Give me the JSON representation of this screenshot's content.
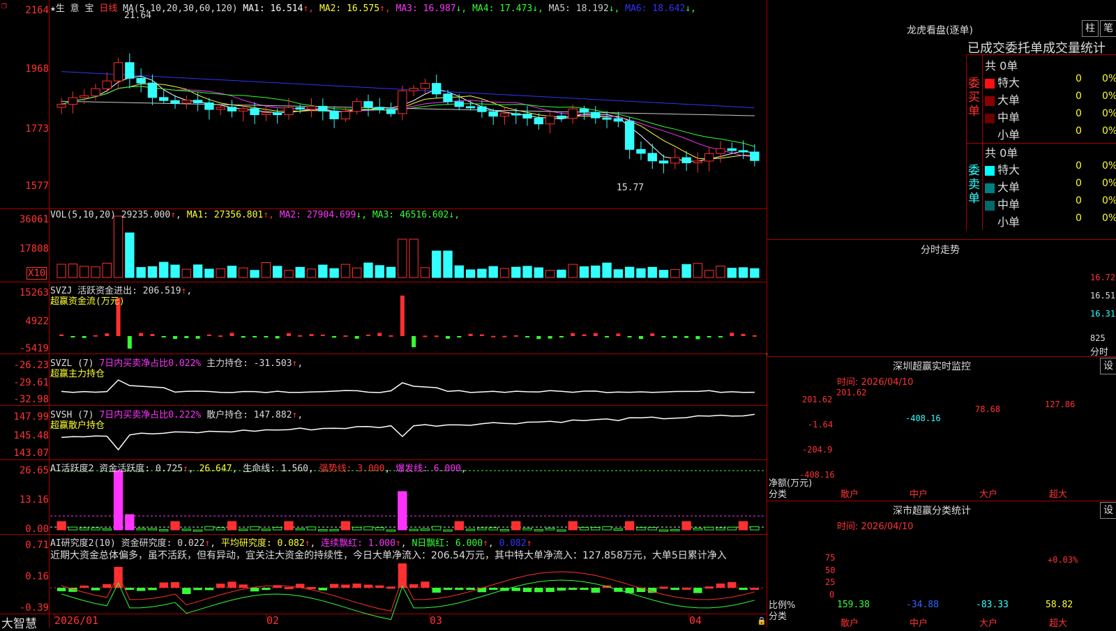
{
  "main_chart": {
    "stock_label": "★生 意 宝",
    "period_label": "日线",
    "ma_params": "MA(5,10,20,30,60,120)",
    "ma_items": [
      {
        "label": "MA1: 16.514",
        "arrow": "↑",
        "color": "#ffffff",
        "arrow_color": "#ff3030"
      },
      {
        "label": "MA2: 16.575",
        "arrow": "↑",
        "color": "#ffff33",
        "arrow_color": "#ff3030"
      },
      {
        "label": "MA3: 16.987",
        "arrow": "↓",
        "color": "#ff33ff",
        "arrow_color": "#33ff33"
      },
      {
        "label": "MA4: 17.473",
        "arrow": "↓",
        "color": "#33ff33",
        "arrow_color": "#33ff33"
      },
      {
        "label": "MA5: 18.192",
        "arrow": "↓",
        "color": "#cccccc",
        "arrow_color": "#33ff33"
      },
      {
        "label": "MA6: 18.642",
        "arrow": "↓",
        "color": "#3333ff",
        "arrow_color": "#33ff33"
      }
    ],
    "y_labels": [
      "2164",
      "1968",
      "1773",
      "1577"
    ],
    "high_annotation": "21.64",
    "low_annotation": "15.77"
  },
  "volume": {
    "header": "VOL(5,10,20)",
    "value": "29235.000",
    "ma_items": [
      {
        "label": "MA1: 27356.801",
        "arrow": "↑",
        "color": "#ffff33",
        "arrow_color": "#ff3030"
      },
      {
        "label": "MA2: 27904.699",
        "arrow": "↓",
        "color": "#ff33ff",
        "arrow_color": "#33ff33"
      },
      {
        "label": "MA3: 46516.602",
        "arrow": "↓",
        "color": "#33ff33",
        "arrow_color": "#33ff33"
      }
    ],
    "y_labels": [
      "36061",
      "17808"
    ],
    "unit_label": "X10"
  },
  "svzj": {
    "header": "SVZJ  活跃资金进出: 206.519",
    "subtitle": "超赢资金流(万元)",
    "y_labels": [
      "15263",
      "4922",
      "-5419"
    ]
  },
  "svzl": {
    "header_a": "SVZL (7)",
    "header_b": "7日内买卖净占比0.022%",
    "header_c": "主力持仓: -31.503",
    "subtitle": "超赢主力持仓",
    "y_labels": [
      "-26.23",
      "-29.61",
      "-32.98"
    ]
  },
  "svsh": {
    "header_a": "SVSH (7)",
    "header_b": "7日内买卖净占比0.222%",
    "header_c": "散户持仓: 147.882",
    "subtitle": "超赢散户持仓",
    "y_labels": [
      "147.99",
      "145.48",
      "143.07"
    ]
  },
  "ai_active": {
    "header_a": "AI活跃度2 资金活跃度: 0.725",
    "header_b": "26.647",
    "header_c": "生命线: 1.560",
    "header_d": "强势线: 3.000",
    "header_e": "爆发线: 6.000",
    "y_labels": [
      "26.65",
      "13.16",
      "0.00"
    ]
  },
  "ai_research": {
    "header_a": "AI研究度2(10) 资金研究度: 0.022",
    "header_b": "平均研究度: 0.082",
    "header_c": "连续飘红: 1.000",
    "header_d": "N日飘红: 6.000",
    "header_e": "0.082",
    "commentary": "近期大资金总体偏多，虽不活跃，但有异动，宜关注大资金的持续性，今日大单净流入：206.54万元，其中特大单净流入：127.858万元，大单5日累计净入",
    "y_labels": [
      "0.71",
      "0.16",
      "-0.39"
    ]
  },
  "x_axis": {
    "labels": [
      "2026/01",
      "02",
      "03",
      "04"
    ],
    "brand": "大智慧"
  },
  "right_panel": {
    "dragon_title": "龙虎看盘(逐单)",
    "tab_column": "柱",
    "tab_stroke": "笔",
    "stats_title": "已成交委托单成交量统计",
    "buy_group": {
      "label": "委买单",
      "total": "共 0单",
      "rows": [
        {
          "name": "特大",
          "count": "0",
          "pct": "0%",
          "color": "#ff1010"
        },
        {
          "name": "大单",
          "count": "0",
          "pct": "0%",
          "color": "#8b0000"
        },
        {
          "name": "中单",
          "count": "0",
          "pct": "0%",
          "color": "#6a0000"
        },
        {
          "name": "小单",
          "count": "0",
          "pct": "0%",
          "color": "#000000"
        }
      ]
    },
    "sell_group": {
      "label": "委卖单",
      "total": "共 0单",
      "rows": [
        {
          "name": "特大",
          "count": "0",
          "pct": "0%",
          "color": "#00ffff"
        },
        {
          "name": "大单",
          "count": "0",
          "pct": "0%",
          "color": "#008080"
        },
        {
          "name": "中单",
          "count": "0",
          "pct": "0%",
          "color": "#006a6a"
        },
        {
          "name": "小单",
          "count": "0",
          "pct": "0%",
          "color": "#000000"
        }
      ]
    },
    "intraday": {
      "title": "分时走势",
      "price_labels": [
        "16.72",
        "16.51",
        "16.31"
      ],
      "vol_label": "825",
      "unit": "分时"
    },
    "sz_monitor": {
      "title": "深圳超赢实时监控",
      "settings": "设",
      "time": "时间: 2026/04/10",
      "y_labels": [
        "201.62",
        "-1.64",
        "-204.9",
        "-408.16"
      ],
      "axis_label": "净额(万元)",
      "category_label": "分类",
      "bars": [
        {
          "name": "散户",
          "value": "201.62"
        },
        {
          "name": "中户",
          "value": "-408.16"
        },
        {
          "name": "大户",
          "value": "78.68"
        },
        {
          "name": "超大",
          "value": "127.86"
        }
      ]
    },
    "sz_classify": {
      "title": "深市超赢分类统计",
      "settings": "设",
      "time": "时间: 2026/04/10",
      "y_labels": [
        "75",
        "50",
        "25",
        "0"
      ],
      "axis_label": "比例%",
      "category_label": "分类",
      "pct_label": "+0.03%",
      "values": [
        {
          "name": "散户",
          "value": "159.38",
          "color": "#33ff33"
        },
        {
          "name": "中户",
          "value": "-34.88",
          "color": "#3366ff"
        },
        {
          "name": "大户",
          "value": "-83.33",
          "color": "#33ffff"
        },
        {
          "name": "超大",
          "value": "58.82",
          "color": "#ffff33"
        }
      ]
    }
  }
}
